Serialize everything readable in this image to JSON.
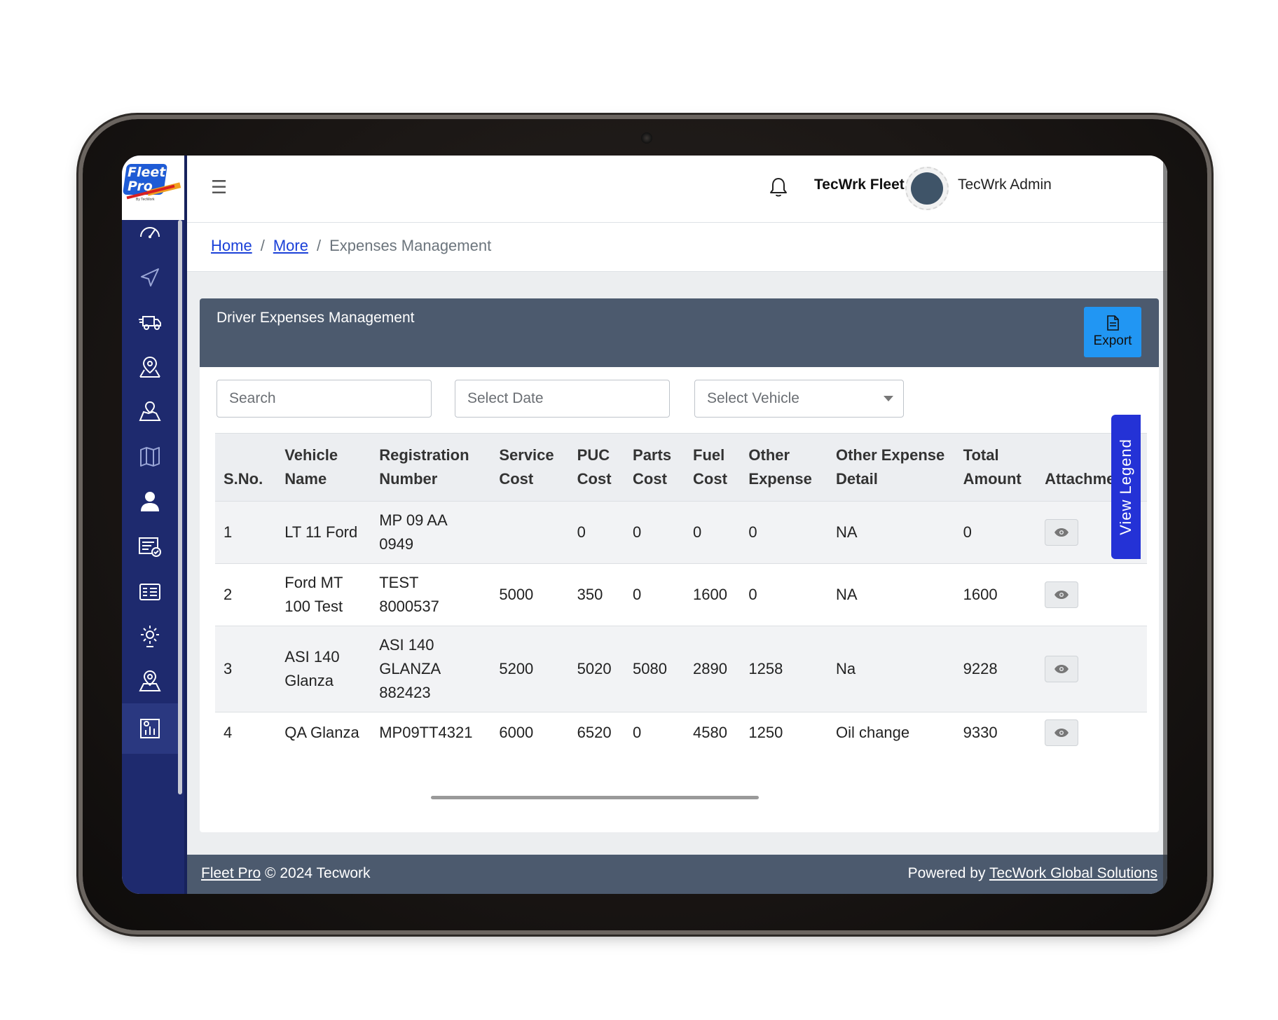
{
  "app": {
    "logo_text": "Fleet Pro",
    "logo_sub": "By TecWork"
  },
  "header": {
    "menu_icon": "hamburger-icon",
    "notification_icon": "bell-icon",
    "brand_name": "TecWrk Fleet",
    "user_name": "TecWrk Admin"
  },
  "breadcrumb": {
    "home": "Home",
    "more": "More",
    "current": "Expenses Management",
    "separator": "/"
  },
  "sidebar": {
    "items": [
      {
        "icon": "speedometer-icon"
      },
      {
        "icon": "send-icon"
      },
      {
        "icon": "truck-icon"
      },
      {
        "icon": "map-pin-icon"
      },
      {
        "icon": "map-location-icon"
      },
      {
        "icon": "map-icon"
      },
      {
        "icon": "user-icon"
      },
      {
        "icon": "checklist-icon"
      },
      {
        "icon": "fuel-card-icon"
      },
      {
        "icon": "settings-gear-icon"
      },
      {
        "icon": "route-pin-icon"
      },
      {
        "icon": "report-chart-icon"
      }
    ]
  },
  "card": {
    "title": "Driver Expenses Management",
    "export_label": "Export"
  },
  "filters": {
    "search_placeholder": "Search",
    "date_placeholder": "Select Date",
    "vehicle_placeholder": "Select Vehicle"
  },
  "table": {
    "headers": {
      "sno": "S.No.",
      "vehicle_name": "Vehicle Name",
      "registration": "Registration Number",
      "service_cost": "Service Cost",
      "puc_cost": "PUC Cost",
      "parts_cost": "Parts Cost",
      "fuel_cost": "Fuel Cost",
      "other_expense": "Other Expense",
      "other_expense_detail": "Other Expense Detail",
      "total_amount": "Total Amount",
      "attachment": "Attachment"
    },
    "rows": [
      {
        "sno": "1",
        "vehicle_name": "LT 11 Ford",
        "registration": "MP 09 AA 0949",
        "service_cost": "",
        "puc_cost": "0",
        "parts_cost": "0",
        "fuel_cost": "0",
        "other_expense": "0",
        "other_expense_detail": "NA",
        "total_amount": "0"
      },
      {
        "sno": "2",
        "vehicle_name": "Ford MT 100 Test",
        "registration": "TEST 8000537",
        "service_cost": "5000",
        "puc_cost": "350",
        "parts_cost": "0",
        "fuel_cost": "1600",
        "other_expense": "0",
        "other_expense_detail": "NA",
        "total_amount": "1600"
      },
      {
        "sno": "3",
        "vehicle_name": "ASI 140 Glanza",
        "registration": "ASI 140 GLANZA 882423",
        "service_cost": "5200",
        "puc_cost": "5020",
        "parts_cost": "5080",
        "fuel_cost": "2890",
        "other_expense": "1258",
        "other_expense_detail": "Na",
        "total_amount": "9228"
      },
      {
        "sno": "4",
        "vehicle_name": "QA Glanza",
        "registration": "MP09TT4321",
        "service_cost": "6000",
        "puc_cost": "6520",
        "parts_cost": "0",
        "fuel_cost": "4580",
        "other_expense": "1250",
        "other_expense_detail": "Oil change",
        "total_amount": "9330"
      }
    ],
    "attachment_icon": "eye-icon"
  },
  "legend": {
    "label": "View Legend"
  },
  "footer": {
    "app_link": "Fleet Pro",
    "copyright": "© 2024 Tecwork",
    "powered_prefix": "Powered by",
    "company_link": "TecWork Global Solutions"
  },
  "colors": {
    "sidebar_bg": "#1e2a6e",
    "card_header_bg": "#4c5a6e",
    "export_btn": "#2196f3",
    "legend_tab": "#2432d6",
    "link": "#1a40d8"
  }
}
